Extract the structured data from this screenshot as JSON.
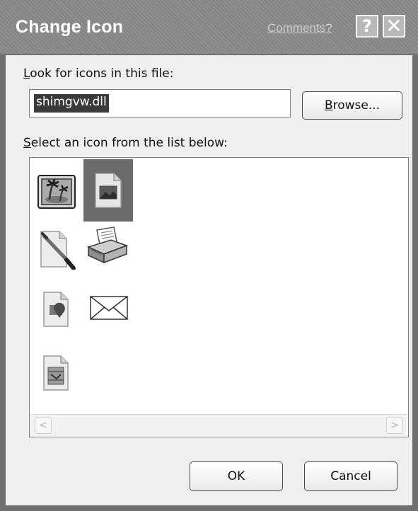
{
  "window": {
    "title": "Change Icon",
    "comments_link": "Comments?",
    "help_button": "?",
    "close_button": "✕"
  },
  "file_section": {
    "label": "Look for icons in this file:",
    "label_hotkey": "L",
    "label_rest": "ook for icons in this file:",
    "value": "shimgvw.dll",
    "browse_label": "Browse...",
    "browse_hotkey": "B",
    "browse_rest": "rowse..."
  },
  "icon_section": {
    "label": "Select an icon from the list below:",
    "label_hotkey": "S",
    "label_rest": "elect an icon from the list below:",
    "icons": [
      {
        "name": "picture-frame-icon"
      },
      {
        "name": "image-document-icon",
        "selected": true
      },
      {
        "name": "paintbrush-document-icon"
      },
      {
        "name": "printer-icon"
      },
      {
        "name": "slideshow-document-icon"
      },
      {
        "name": "envelope-icon"
      },
      {
        "name": "film-document-icon"
      }
    ],
    "scroll_left": "<",
    "scroll_right": ">"
  },
  "footer": {
    "ok_label": "OK",
    "cancel_label": "Cancel"
  }
}
